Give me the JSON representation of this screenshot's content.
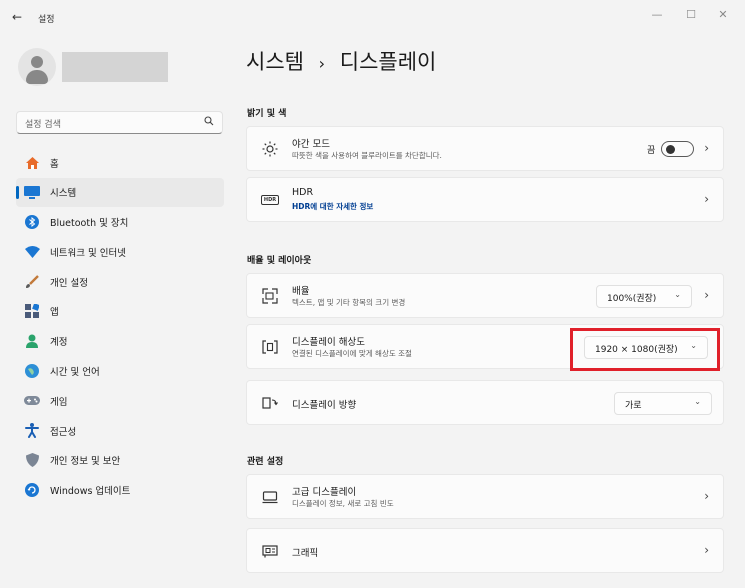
{
  "window": {
    "back_glyph": "←",
    "app_title": "설정",
    "controls": {
      "minimize": "—",
      "maximize": "☐",
      "close": "✕"
    }
  },
  "sidebar": {
    "search": {
      "placeholder": "설정 검색"
    },
    "items": [
      {
        "label": "홈",
        "icon": "home-icon",
        "selected": false
      },
      {
        "label": "시스템",
        "icon": "system-icon",
        "selected": true
      },
      {
        "label": "Bluetooth 및 장치",
        "icon": "bluetooth-icon",
        "selected": false
      },
      {
        "label": "네트워크 및 인터넷",
        "icon": "network-icon",
        "selected": false
      },
      {
        "label": "개인 설정",
        "icon": "brush-icon",
        "selected": false
      },
      {
        "label": "앱",
        "icon": "apps-icon",
        "selected": false
      },
      {
        "label": "계정",
        "icon": "account-icon",
        "selected": false
      },
      {
        "label": "시간 및 언어",
        "icon": "globe-icon",
        "selected": false
      },
      {
        "label": "게임",
        "icon": "gamepad-icon",
        "selected": false
      },
      {
        "label": "접근성",
        "icon": "accessibility-icon",
        "selected": false
      },
      {
        "label": "개인 정보 및 보안",
        "icon": "shield-icon",
        "selected": false
      },
      {
        "label": "Windows 업데이트",
        "icon": "update-icon",
        "selected": false
      }
    ]
  },
  "main": {
    "breadcrumb": {
      "parent": "시스템",
      "separator": "›",
      "current": "디스플레이"
    },
    "sections": {
      "brightness": "밝기 및 색",
      "scale_layout": "배율 및 레이아웃",
      "related": "관련 설정"
    },
    "night_light": {
      "title": "야간 모드",
      "subtitle": "따뜻한 색을 사용하여 블루라이트를 차단합니다.",
      "state_label": "끔",
      "on": false
    },
    "hdr": {
      "title": "HDR",
      "link": "HDR에 대한 자세한 정보",
      "icon_text": "HDR"
    },
    "scale": {
      "title": "배율",
      "subtitle": "텍스트, 앱 및 기타 항목의 크기 변경",
      "value": "100%(권장)"
    },
    "resolution": {
      "title": "디스플레이 해상도",
      "subtitle": "연결된 디스플레이에 맞게 해상도 조절",
      "value": "1920 × 1080(권장)"
    },
    "orientation": {
      "title": "디스플레이 방향",
      "value": "가로"
    },
    "advanced_display": {
      "title": "고급 디스플레이",
      "subtitle": "디스플레이 정보, 새로 고침 빈도"
    },
    "graphics": {
      "title": "그래픽"
    }
  },
  "colors": {
    "accent": "#0067c0",
    "highlight_box": "#e0202a"
  }
}
